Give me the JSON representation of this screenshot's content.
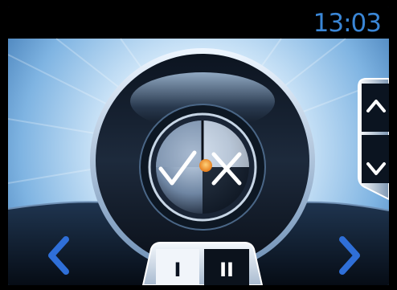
{
  "status_bar": {
    "time": "13:03"
  },
  "colors": {
    "accent": "#3a86d6",
    "background": "#000000",
    "knob_dot": "#f08a1a"
  },
  "dial": {
    "left_symbol": "check-icon",
    "right_symbol": "cross-icon"
  },
  "side_panel": {
    "up_icon": "chevron-up-icon",
    "down_icon": "chevron-down-icon"
  },
  "nav": {
    "left_icon": "arrow-left-icon",
    "right_icon": "arrow-right-icon"
  },
  "mode_selector": {
    "option_1": "I",
    "option_2": "II",
    "selected": "II"
  }
}
